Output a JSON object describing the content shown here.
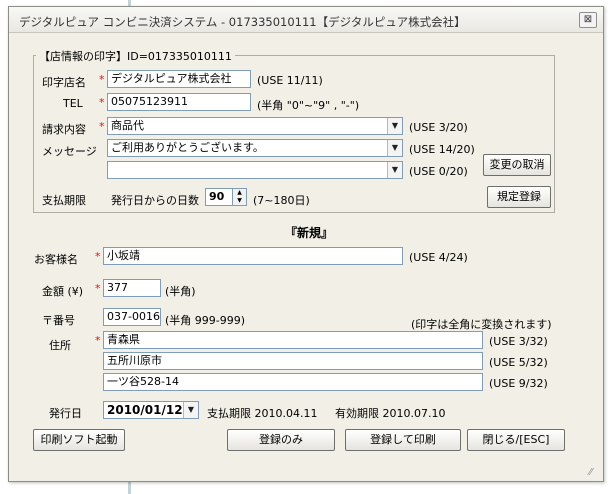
{
  "window": {
    "title": "デジタルピュア コンビニ決済システム - 017335010111【デジタルピュア株式会社】",
    "close_glyph": "⊠"
  },
  "store_section": {
    "legend": "【店情報の印字】ID=017335010111",
    "store_name_label": "印字店名",
    "store_name_value": "デジタルピュア株式会社",
    "store_name_use": "(USE 11/11)",
    "tel_label": "TEL",
    "tel_value": "05075123911",
    "tel_hint": "(半角 \"0\"~\"9\" , \"-\")",
    "billing_label": "請求内容",
    "billing_value": "商品代",
    "billing_use": "(USE 3/20)",
    "message_label": "メッセージ",
    "message1_value": "ご利用ありがとうございます。",
    "message1_use": "(USE 14/20)",
    "message2_value": "",
    "message2_use": "(USE 0/20)",
    "due_label": "支払期限",
    "due_text": "発行日からの日数",
    "due_value": "90",
    "due_range": "(7~180日)",
    "cancel_changes_label": "変更の取消",
    "default_register_label": "規定登録"
  },
  "mode_label": "『新規』",
  "customer": {
    "name_label": "お客様名",
    "name_value": "小坂靖",
    "name_use": "(USE 4/24)",
    "amount_label": "金額 (¥)",
    "amount_value": "377",
    "amount_hint": "(半角)",
    "zip_label": "〒番号",
    "zip_value": "037-0016",
    "zip_hint": "(半角 999-999)",
    "fullwidth_note": "(印字は全角に変換されます)",
    "address_label": "住所",
    "address1_value": "青森県",
    "address1_use": "(USE 3/32)",
    "address2_value": "五所川原市",
    "address2_use": "(USE 5/32)",
    "address3_value": "一ツ谷528-14",
    "address3_use": "(USE 9/32)"
  },
  "issue": {
    "date_label": "発行日",
    "date_value": "2010/01/12",
    "due_text": "支払期限 2010.04.11",
    "valid_text": "有効期限 2010.07.10"
  },
  "buttons": {
    "print_soft": "印刷ソフト起動",
    "register_only": "登録のみ",
    "register_print": "登録して印刷",
    "close": "閉じる/[ESC]"
  },
  "required_mark": "*",
  "icons": {
    "dropdown": "▼",
    "spin_up": "▲",
    "spin_down": "▼",
    "grip": "⁄⁄"
  }
}
